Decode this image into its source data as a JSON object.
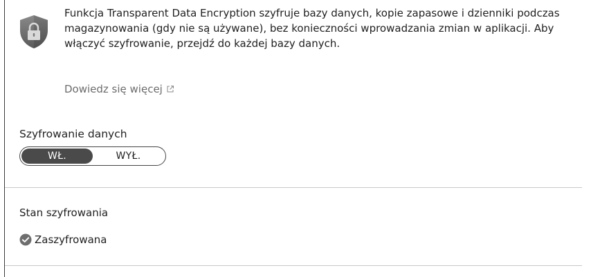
{
  "info": {
    "description": "Funkcja Transparent Data Encryption szyfruje bazy danych, kopie zapasowe i dzienniki podczas magazynowania (gdy nie są używane), bez konieczności wprowadzania zmian w aplikacji. Aby włączyć szyfrowanie, przejdź do każdej bazy danych.",
    "learn_more": "Dowiedz się więcej",
    "icon": "shield-lock-icon"
  },
  "encryption": {
    "label": "Szyfrowanie danych",
    "options": [
      "WŁ.",
      "WYŁ."
    ],
    "selected": "WŁ."
  },
  "status": {
    "label": "Stan szyfrowania",
    "value": "Zaszyfrowana",
    "icon": "check-circle-icon"
  }
}
